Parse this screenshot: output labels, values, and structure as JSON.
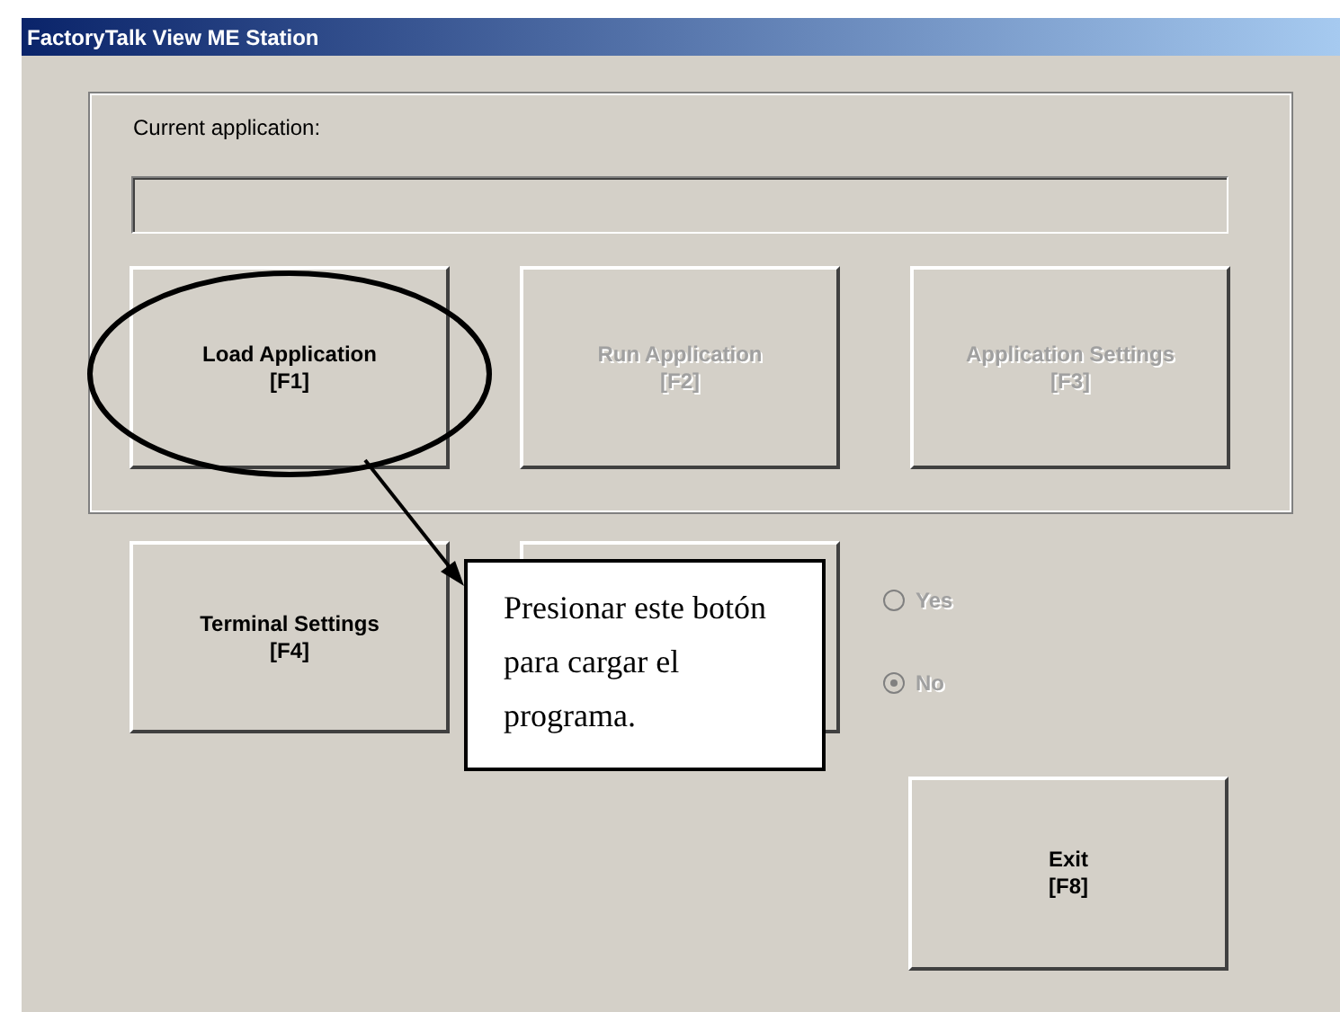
{
  "window": {
    "title": "FactoryTalk View ME Station"
  },
  "current_application": {
    "label": "Current application:"
  },
  "application_buttons": [
    {
      "label": "Load Application",
      "key": "[F1]",
      "disabled": false
    },
    {
      "label": "Run Application",
      "key": "[F2]",
      "disabled": true
    },
    {
      "label": "Application Settings",
      "key": "[F3]",
      "disabled": true
    }
  ],
  "terminal_button": {
    "label": "Terminal Settings",
    "key": "[F4]",
    "disabled": false
  },
  "radios": [
    {
      "label": "Yes",
      "selected": false,
      "disabled": true
    },
    {
      "label": "No",
      "selected": true,
      "disabled": true
    }
  ],
  "exit_button": {
    "label": "Exit",
    "key": "[F8]",
    "disabled": false
  },
  "callout": {
    "text": "Presionar este botón para cargar el programa."
  }
}
